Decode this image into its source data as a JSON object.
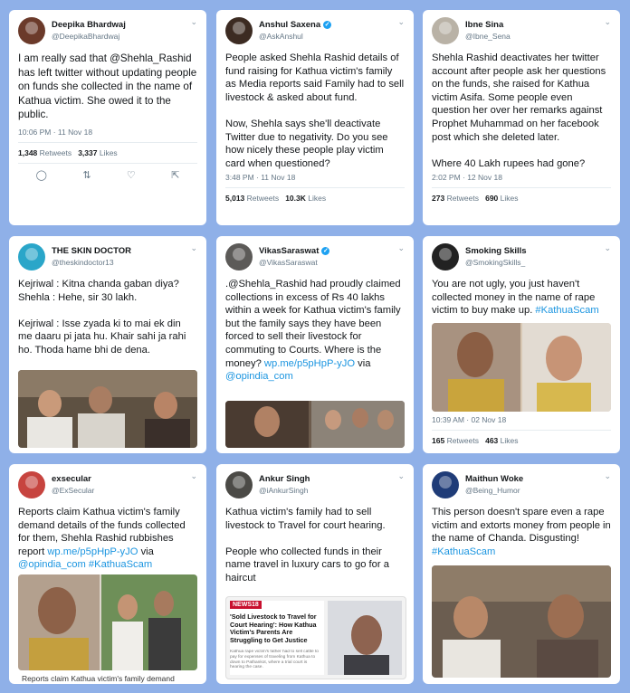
{
  "tweets": [
    {
      "name": "Deepika Bhardwaj",
      "handle": "@DeepikaBhardwaj",
      "text": "I am really sad that @Shehla_Rashid has left twitter without updating people on funds she collected in the name of Kathua victim. She owed it to the public.",
      "time": "10:06 PM · 11 Nov 18",
      "retweets": "1,348",
      "retweets_label": "Retweets",
      "likes": "3,337",
      "likes_label": "Likes"
    },
    {
      "name": "Anshul Saxena",
      "handle": "@AskAnshul",
      "text": "People asked Shehla Rashid details of fund raising for Kathua victim's family as Media reports said Family had to sell livestock & asked about fund.\n\nNow, Shehla says she'll deactivate Twitter due to negativity. Do you see how nicely these people play victim card when questioned?",
      "time": "3:48 PM · 11 Nov 18",
      "retweets": "5,013",
      "retweets_label": "Retweets",
      "likes": "10.3K",
      "likes_label": "Likes"
    },
    {
      "name": "Ibne Sina",
      "handle": "@Ibne_Sena",
      "text": "Shehla Rashid deactivates her twitter account after people ask her questions on the funds, she raised for Kathua victim Asifa. Some people even question her over her remarks against Prophet Muhammad on her facebook post which she deleted later.\n\nWhere 40 Lakh rupees had gone?",
      "time": "2:02 PM · 12 Nov 18",
      "retweets": "273",
      "retweets_label": "Retweets",
      "likes": "690",
      "likes_label": "Likes"
    },
    {
      "name": "THE SKIN DOCTOR",
      "handle": "@theskindoctor13",
      "text": "Kejriwal : Kitna chanda gaban diya?\nShehla : Hehe, sir 30 lakh.\n\nKejriwal : Isse zyada ki to mai ek din me daaru pi jata hu. Khair sahi ja rahi ho. Thoda hame bhi de dena."
    },
    {
      "name": "VikasSaraswat",
      "handle": "@VikasSaraswat",
      "text": ".@Shehla_Rashid had proudly claimed collections in excess of Rs 40 lakhs within a week for Kathua victim's family but the family says they have been forced to sell their livestock for commuting to Courts. Where is the money?",
      "link1": "wp.me/p5pHpP-yJO",
      "via": "via",
      "link2": "@opindia_com"
    },
    {
      "name": "Smoking Skills",
      "handle": "@SmokingSkills_",
      "text": "You are not ugly, you just haven't collected money in the name of rape victim to buy make up.",
      "hashtag": "#KathuaScam",
      "time": "10:39 AM · 02 Nov 18",
      "retweets": "165",
      "retweets_label": "Retweets",
      "likes": "463",
      "likes_label": "Likes"
    },
    {
      "name": "exsecular",
      "handle": "@ExSecular",
      "text": "Reports claim Kathua victim's family demand details of the funds collected for them, Shehla Rashid rubbishes report",
      "link1": "wp.me/p5pHpP-yJO",
      "via": "via",
      "link2": "@opindia_com",
      "hashtag": "#KathuaScam",
      "caption": "Reports claim Kathua victim's family demand"
    },
    {
      "name": "Ankur Singh",
      "handle": "@iAnkurSingh",
      "text": "Kathua victim's family had to sell livestock to Travel for court hearing.\n\nPeople who collected funds in their name travel in luxury cars to go for a haircut",
      "news_logo": "NEWS18",
      "news_headline": "'Sold Livestock to Travel for Court Hearing': How Kathua Victim's Parents Are Struggling to Get Justice",
      "news_sub": "Kathua rape victim's father had to sell cattle to pay for expenses of traveling from Kathua to down to Pathankot, where a trial court is hearing the case."
    },
    {
      "name": "Maithun Woke",
      "handle": "@Being_Humor",
      "text": "This person doesn't spare even a rape victim and extorts money from people in the name of Chanda. Disgusting!",
      "hashtag": "#KathuaScam"
    }
  ],
  "colors": {
    "background": "#8fb0e8",
    "link": "#1b95e0",
    "verified": "#1da1f2"
  }
}
